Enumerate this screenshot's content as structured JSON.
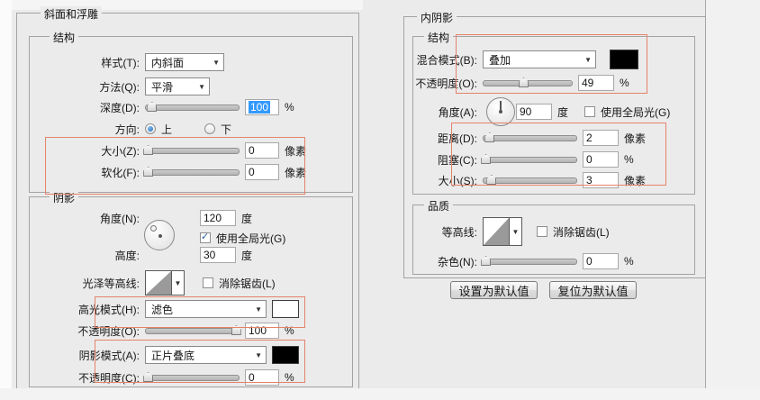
{
  "colors": {
    "background": "#ebebeb",
    "annotation_red": "#e5826a",
    "selection_blue": "#3399ff",
    "swatch_black": "#000000",
    "swatch_white": "#ffffff"
  },
  "left_panel": {
    "title": "斜面和浮雕",
    "structure": {
      "title": "结构",
      "style_label": "样式(T):",
      "style_value": "内斜面",
      "method_label": "方法(Q):",
      "method_value": "平滑",
      "depth_label": "深度(D):",
      "depth_value": "100",
      "depth_unit": "%",
      "depth_value_selected": true,
      "direction_label": "方向:",
      "direction_up": "上",
      "direction_down": "下",
      "direction_selected": "上",
      "size_label": "大小(Z):",
      "size_value": "0",
      "size_unit": "像素",
      "soften_label": "软化(F):",
      "soften_value": "0",
      "soften_unit": "像素"
    },
    "shading": {
      "title": "阴影",
      "angle_label": "角度(N):",
      "angle_value": "120",
      "angle_unit": "度",
      "global_light_label": "使用全局光(G)",
      "global_light_checked": true,
      "altitude_label": "高度:",
      "altitude_value": "30",
      "altitude_unit": "度",
      "gloss_contour_label": "光泽等高线:",
      "gloss_anti_alias_label": "消除锯齿(L)",
      "gloss_anti_alias_checked": false,
      "highlight_mode_label": "高光模式(H):",
      "highlight_mode_value": "滤色",
      "highlight_color": "#ffffff",
      "highlight_opacity_label": "不透明度(O):",
      "highlight_opacity_value": "100",
      "highlight_opacity_unit": "%",
      "shadow_mode_label": "阴影模式(A):",
      "shadow_mode_value": "正片叠底",
      "shadow_color": "#000000",
      "shadow_opacity_label": "不透明度(C):",
      "shadow_opacity_value": "0",
      "shadow_opacity_unit": "%"
    }
  },
  "right_panel": {
    "title": "内阴影",
    "structure": {
      "title": "结构",
      "blend_label": "混合模式(B):",
      "blend_value": "叠加",
      "blend_color": "#000000",
      "opacity_label": "不透明度(O):",
      "opacity_value": "49",
      "opacity_unit": "%",
      "angle_label": "角度(A):",
      "angle_value": "90",
      "angle_unit": "度",
      "global_light_label": "使用全局光(G)",
      "global_light_checked": false,
      "distance_label": "距离(D):",
      "distance_value": "2",
      "distance_unit": "像素",
      "choke_label": "阻塞(C):",
      "choke_value": "0",
      "choke_unit": "%",
      "size_label": "大小(S):",
      "size_value": "3",
      "size_unit": "像素"
    },
    "quality": {
      "title": "品质",
      "contour_label": "等高线:",
      "anti_alias_label": "消除锯齿(L)",
      "anti_alias_checked": false,
      "noise_label": "杂色(N):",
      "noise_value": "0",
      "noise_unit": "%"
    },
    "buttons": {
      "set_default": "设置为默认值",
      "reset_default": "复位为默认值"
    }
  }
}
